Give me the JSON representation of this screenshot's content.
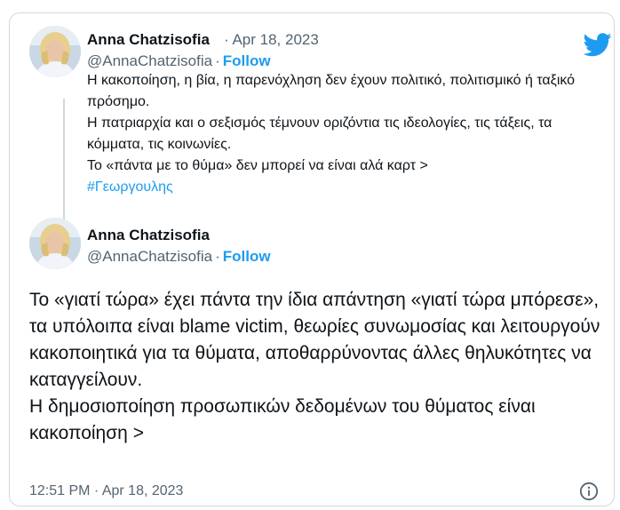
{
  "twitter_icon": "twitter-bird-icon",
  "brand_color": "#1d9bf0",
  "quoted_tweet": {
    "author_name": "Anna Chatzisofia",
    "date": "Apr 18, 2023",
    "date_separator": "·",
    "handle": "@AnnaChatzisofia",
    "handle_separator": "·",
    "follow_label": "Follow",
    "lines": [
      "Η κακοποίηση, η βία, η παρενόχληση δεν έχουν πολιτικό, πολιτισμικό ή ταξικό πρόσημο.",
      "Η πατριαρχία και ο σεξισμός τέμνουν οριζόντια τις ιδεολογίες, τις τάξεις, τα κόμματα, τις κοινωνίες.",
      "Το «πάντα με το θύμα» δεν μπορεί να είναι αλά καρτ >"
    ],
    "hashtag": "#Γεωργουλης"
  },
  "main_tweet": {
    "author_name": "Anna Chatzisofia",
    "handle": "@AnnaChatzisofia",
    "handle_separator": "·",
    "follow_label": "Follow",
    "paragraphs": [
      "Το «γιατί τώρα» έχει πάντα την ίδια απάντηση «γιατί τώρα μπόρεσε», τα υπόλοιπα είναι blame victim, θεωρίες συνωμοσίας και λειτουργούν κακοποιητικά για τα θύματα, αποθαρρύνοντας άλλες θηλυκότητες να καταγγείλουν.",
      "Η δημοσιοποίηση προσωπικών δεδομένων του θύματος είναι κακοποίηση >"
    ],
    "timestamp": "12:51 PM · Apr 18, 2023"
  },
  "info_icon": "info-icon"
}
